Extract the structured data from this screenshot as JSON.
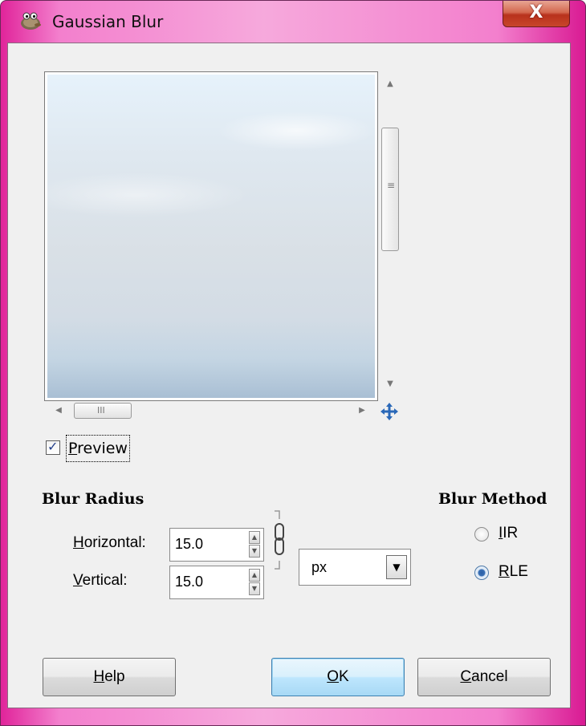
{
  "window": {
    "title": "Gaussian Blur",
    "app_icon": "gimp-wilber-icon",
    "close_label": "X"
  },
  "preview": {
    "checkbox_label": "Preview",
    "checked": true
  },
  "blur_radius": {
    "title": "Blur Radius",
    "horizontal_label": "Horizontal:",
    "horizontal_value": "15.0",
    "vertical_label": "Vertical:",
    "vertical_value": "15.0",
    "unit": "px",
    "chained": true
  },
  "blur_method": {
    "title": "Blur Method",
    "options": [
      {
        "label": "IIR",
        "selected": false
      },
      {
        "label": "RLE",
        "selected": true
      }
    ]
  },
  "buttons": {
    "help": "Help",
    "ok": "OK",
    "cancel": "Cancel"
  },
  "colors": {
    "frame_accent": "#f37fcd",
    "close_button": "#c8452b",
    "default_button": "#bee6fd",
    "dialog_background": "#f0f0f0"
  }
}
